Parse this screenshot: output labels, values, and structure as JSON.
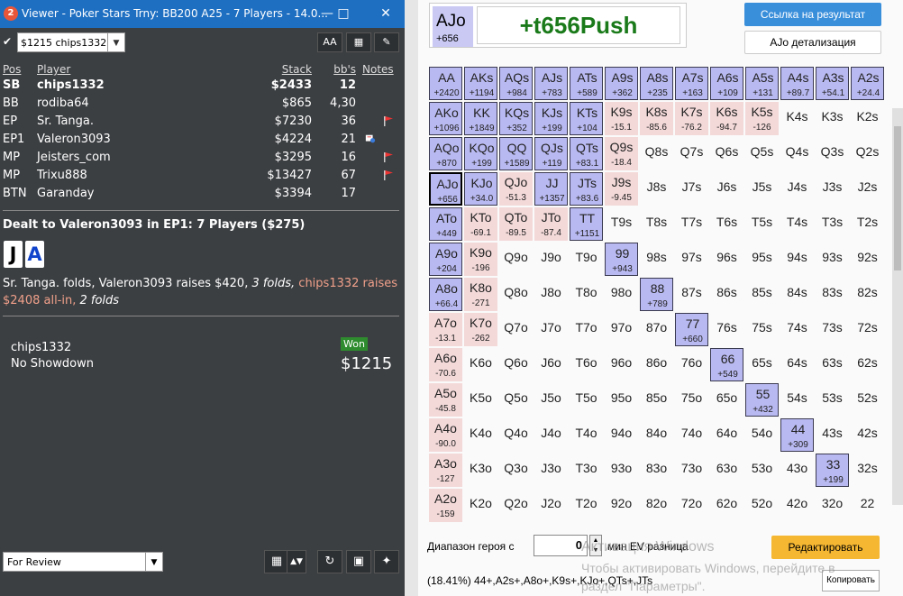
{
  "viewer": {
    "logo": "2",
    "title": "Viewer - Poker Stars Trny: BB200 A25 - 7 Players - 14.0...",
    "hand_select": "$1215 chips1332",
    "font_btn": "AA",
    "headers": {
      "pos": "Pos",
      "player": "Player",
      "stack": "Stack",
      "bbs": "bb's",
      "notes": "Notes"
    },
    "players": [
      {
        "pos": "SB",
        "name": "chips1332",
        "stack": "$2433",
        "bbs": "12",
        "bold": true
      },
      {
        "pos": "BB",
        "name": "rodiba64",
        "stack": "$865",
        "bbs": "4,30"
      },
      {
        "pos": "EP",
        "name": "Sr. Tanga.",
        "stack": "$7230",
        "bbs": "36"
      },
      {
        "pos": "EP1",
        "name": "Valeron3093",
        "stack": "$4224",
        "bbs": "21"
      },
      {
        "pos": "MP",
        "name": "Jeisters_com",
        "stack": "$3295",
        "bbs": "16"
      },
      {
        "pos": "MP",
        "name": "Trixu888",
        "stack": "$13427",
        "bbs": "67"
      },
      {
        "pos": "BTN",
        "name": "Garanday",
        "stack": "$3394",
        "bbs": "17"
      }
    ],
    "dealt": "Dealt to Valeron3093 in EP1: 7 Players ($275)",
    "cards": [
      "J",
      "A"
    ],
    "action_1": "Sr. Tanga. folds, Valeron3093 raises $420, ",
    "action_2": "3 folds, ",
    "action_3": "chips1332 raises $2408 all-in, ",
    "action_4": "2 folds",
    "result_player": "chips1332",
    "result_desc": "No Showdown",
    "won_label": "Won",
    "won_amount": "$1215",
    "review_select": "For Review"
  },
  "panel": {
    "combo_hand": "AJo",
    "combo_value": "+656",
    "result": "+t656Push",
    "link_button": "Ссылка на результат",
    "detail_button": "AJo детализация",
    "hero_label": "Диапазон героя с",
    "hero_value": "0",
    "ev_label": "мин EV разница",
    "edit_button": "Редактировать",
    "range_text": "(18.41%) 44+,A2s+,A8o+,K9s+,KJo+,QTs+,JTs",
    "copy_button": "Копировать",
    "watermark_1": "Активация Windows",
    "watermark_2": "Чтобы активировать Windows, перейдите в",
    "watermark_3": "раздел \"Параметры\"."
  },
  "grid": [
    [
      [
        "AA",
        "+2420",
        "b"
      ],
      [
        "AKs",
        "+1194",
        "b"
      ],
      [
        "AQs",
        "+984",
        "b"
      ],
      [
        "AJs",
        "+783",
        "b"
      ],
      [
        "ATs",
        "+589",
        "b"
      ],
      [
        "A9s",
        "+362",
        "b"
      ],
      [
        "A8s",
        "+235",
        "b"
      ],
      [
        "A7s",
        "+163",
        "b"
      ],
      [
        "A6s",
        "+109",
        "b"
      ],
      [
        "A5s",
        "+131",
        "b"
      ],
      [
        "A4s",
        "+89.7",
        "b"
      ],
      [
        "A3s",
        "+54.1",
        "b"
      ],
      [
        "A2s",
        "+24.4",
        "b"
      ]
    ],
    [
      [
        "AKo",
        "+1096",
        "b"
      ],
      [
        "KK",
        "+1849",
        "b"
      ],
      [
        "KQs",
        "+352",
        "b"
      ],
      [
        "KJs",
        "+199",
        "b"
      ],
      [
        "KTs",
        "+104",
        "b"
      ],
      [
        "K9s",
        "-15.1",
        "p"
      ],
      [
        "K8s",
        "-85.6",
        "p"
      ],
      [
        "K7s",
        "-76.2",
        "p"
      ],
      [
        "K6s",
        "-94.7",
        "p"
      ],
      [
        "K5s",
        "-126",
        "p"
      ],
      [
        "K4s",
        "",
        ""
      ],
      [
        "K3s",
        "",
        ""
      ],
      [
        "K2s",
        "",
        ""
      ]
    ],
    [
      [
        "AQo",
        "+870",
        "b"
      ],
      [
        "KQo",
        "+199",
        "b"
      ],
      [
        "QQ",
        "+1589",
        "b"
      ],
      [
        "QJs",
        "+119",
        "b"
      ],
      [
        "QTs",
        "+83.1",
        "b"
      ],
      [
        "Q9s",
        "-18.4",
        "p"
      ],
      [
        "Q8s",
        "",
        ""
      ],
      [
        "Q7s",
        "",
        ""
      ],
      [
        "Q6s",
        "",
        ""
      ],
      [
        "Q5s",
        "",
        ""
      ],
      [
        "Q4s",
        "",
        ""
      ],
      [
        "Q3s",
        "",
        ""
      ],
      [
        "Q2s",
        "",
        ""
      ]
    ],
    [
      [
        "AJo",
        "+656",
        "bs"
      ],
      [
        "KJo",
        "+34.0",
        "b"
      ],
      [
        "QJo",
        "-51.3",
        "p"
      ],
      [
        "JJ",
        "+1357",
        "b"
      ],
      [
        "JTs",
        "+83.6",
        "b"
      ],
      [
        "J9s",
        "-9.45",
        "p"
      ],
      [
        "J8s",
        "",
        ""
      ],
      [
        "J7s",
        "",
        ""
      ],
      [
        "J6s",
        "",
        ""
      ],
      [
        "J5s",
        "",
        ""
      ],
      [
        "J4s",
        "",
        ""
      ],
      [
        "J3s",
        "",
        ""
      ],
      [
        "J2s",
        "",
        ""
      ]
    ],
    [
      [
        "ATo",
        "+449",
        "b"
      ],
      [
        "KTo",
        "-69.1",
        "p"
      ],
      [
        "QTo",
        "-89.5",
        "p"
      ],
      [
        "JTo",
        "-87.4",
        "p"
      ],
      [
        "TT",
        "+1151",
        "b"
      ],
      [
        "T9s",
        "",
        ""
      ],
      [
        "T8s",
        "",
        ""
      ],
      [
        "T7s",
        "",
        ""
      ],
      [
        "T6s",
        "",
        ""
      ],
      [
        "T5s",
        "",
        ""
      ],
      [
        "T4s",
        "",
        ""
      ],
      [
        "T3s",
        "",
        ""
      ],
      [
        "T2s",
        "",
        ""
      ]
    ],
    [
      [
        "A9o",
        "+204",
        "b"
      ],
      [
        "K9o",
        "-196",
        "p"
      ],
      [
        "Q9o",
        "",
        ""
      ],
      [
        "J9o",
        "",
        ""
      ],
      [
        "T9o",
        "",
        ""
      ],
      [
        "99",
        "+943",
        "b"
      ],
      [
        "98s",
        "",
        ""
      ],
      [
        "97s",
        "",
        ""
      ],
      [
        "96s",
        "",
        ""
      ],
      [
        "95s",
        "",
        ""
      ],
      [
        "94s",
        "",
        ""
      ],
      [
        "93s",
        "",
        ""
      ],
      [
        "92s",
        "",
        ""
      ]
    ],
    [
      [
        "A8o",
        "+66.4",
        "b"
      ],
      [
        "K8o",
        "-271",
        "p"
      ],
      [
        "Q8o",
        "",
        ""
      ],
      [
        "J8o",
        "",
        ""
      ],
      [
        "T8o",
        "",
        ""
      ],
      [
        "98o",
        "",
        ""
      ],
      [
        "88",
        "+789",
        "b"
      ],
      [
        "87s",
        "",
        ""
      ],
      [
        "86s",
        "",
        ""
      ],
      [
        "85s",
        "",
        ""
      ],
      [
        "84s",
        "",
        ""
      ],
      [
        "83s",
        "",
        ""
      ],
      [
        "82s",
        "",
        ""
      ]
    ],
    [
      [
        "A7o",
        "-13.1",
        "p"
      ],
      [
        "K7o",
        "-262",
        "p"
      ],
      [
        "Q7o",
        "",
        ""
      ],
      [
        "J7o",
        "",
        ""
      ],
      [
        "T7o",
        "",
        ""
      ],
      [
        "97o",
        "",
        ""
      ],
      [
        "87o",
        "",
        ""
      ],
      [
        "77",
        "+660",
        "b"
      ],
      [
        "76s",
        "",
        ""
      ],
      [
        "75s",
        "",
        ""
      ],
      [
        "74s",
        "",
        ""
      ],
      [
        "73s",
        "",
        ""
      ],
      [
        "72s",
        "",
        ""
      ]
    ],
    [
      [
        "A6o",
        "-70.6",
        "p"
      ],
      [
        "K6o",
        "",
        ""
      ],
      [
        "Q6o",
        "",
        ""
      ],
      [
        "J6o",
        "",
        ""
      ],
      [
        "T6o",
        "",
        ""
      ],
      [
        "96o",
        "",
        ""
      ],
      [
        "86o",
        "",
        ""
      ],
      [
        "76o",
        "",
        ""
      ],
      [
        "66",
        "+549",
        "b"
      ],
      [
        "65s",
        "",
        ""
      ],
      [
        "64s",
        "",
        ""
      ],
      [
        "63s",
        "",
        ""
      ],
      [
        "62s",
        "",
        ""
      ]
    ],
    [
      [
        "A5o",
        "-45.8",
        "p"
      ],
      [
        "K5o",
        "",
        ""
      ],
      [
        "Q5o",
        "",
        ""
      ],
      [
        "J5o",
        "",
        ""
      ],
      [
        "T5o",
        "",
        ""
      ],
      [
        "95o",
        "",
        ""
      ],
      [
        "85o",
        "",
        ""
      ],
      [
        "75o",
        "",
        ""
      ],
      [
        "65o",
        "",
        ""
      ],
      [
        "55",
        "+432",
        "b"
      ],
      [
        "54s",
        "",
        ""
      ],
      [
        "53s",
        "",
        ""
      ],
      [
        "52s",
        "",
        ""
      ]
    ],
    [
      [
        "A4o",
        "-90.0",
        "p"
      ],
      [
        "K4o",
        "",
        ""
      ],
      [
        "Q4o",
        "",
        ""
      ],
      [
        "J4o",
        "",
        ""
      ],
      [
        "T4o",
        "",
        ""
      ],
      [
        "94o",
        "",
        ""
      ],
      [
        "84o",
        "",
        ""
      ],
      [
        "74o",
        "",
        ""
      ],
      [
        "64o",
        "",
        ""
      ],
      [
        "54o",
        "",
        ""
      ],
      [
        "44",
        "+309",
        "b"
      ],
      [
        "43s",
        "",
        ""
      ],
      [
        "42s",
        "",
        ""
      ]
    ],
    [
      [
        "A3o",
        "-127",
        "p"
      ],
      [
        "K3o",
        "",
        ""
      ],
      [
        "Q3o",
        "",
        ""
      ],
      [
        "J3o",
        "",
        ""
      ],
      [
        "T3o",
        "",
        ""
      ],
      [
        "93o",
        "",
        ""
      ],
      [
        "83o",
        "",
        ""
      ],
      [
        "73o",
        "",
        ""
      ],
      [
        "63o",
        "",
        ""
      ],
      [
        "53o",
        "",
        ""
      ],
      [
        "43o",
        "",
        ""
      ],
      [
        "33",
        "+199",
        "b"
      ],
      [
        "32s",
        "",
        ""
      ]
    ],
    [
      [
        "A2o",
        "-159",
        "p"
      ],
      [
        "K2o",
        "",
        ""
      ],
      [
        "Q2o",
        "",
        ""
      ],
      [
        "J2o",
        "",
        ""
      ],
      [
        "T2o",
        "",
        ""
      ],
      [
        "92o",
        "",
        ""
      ],
      [
        "82o",
        "",
        ""
      ],
      [
        "72o",
        "",
        ""
      ],
      [
        "62o",
        "",
        ""
      ],
      [
        "52o",
        "",
        ""
      ],
      [
        "42o",
        "",
        ""
      ],
      [
        "32o",
        "",
        ""
      ],
      [
        "22",
        "",
        ""
      ]
    ]
  ],
  "colors": {
    "range": "#b9b9f2",
    "negative": "#f4d9d9",
    "result": "#1a7a1a",
    "title": "#1e6fc2",
    "edit": "#f5b731"
  }
}
